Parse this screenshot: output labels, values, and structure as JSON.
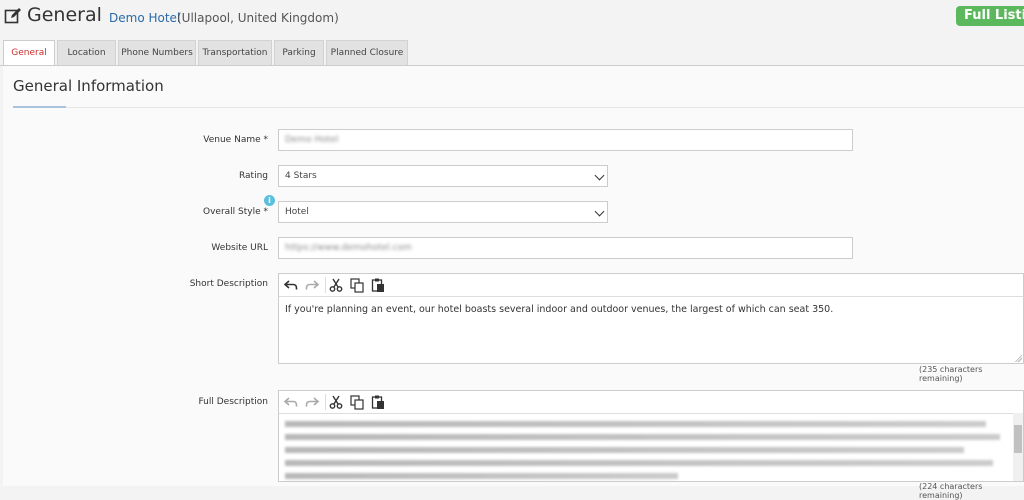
{
  "header": {
    "title": "General",
    "hotel_name": "Demo Hotel",
    "location": "(Ullapool, United Kingdom)",
    "full_listing_button": "Full Listing"
  },
  "tabs": [
    {
      "label": "General",
      "active": true
    },
    {
      "label": "Location",
      "active": false
    },
    {
      "label": "Phone Numbers",
      "active": false
    },
    {
      "label": "Transportation",
      "active": false
    },
    {
      "label": "Parking",
      "active": false
    },
    {
      "label": "Planned Closure",
      "active": false
    }
  ],
  "section": {
    "title": "General Information"
  },
  "form": {
    "venue_name": {
      "label": "Venue Name *",
      "value": "Demo Hotel"
    },
    "rating": {
      "label": "Rating",
      "value": "4 Stars"
    },
    "overall_style": {
      "label": "Overall Style *",
      "value": "Hotel",
      "info_icon": "i"
    },
    "website_url": {
      "label": "Website URL",
      "value": "https://www.demohotel.com"
    },
    "short_description": {
      "label": "Short Description",
      "text": "If you're planning an event, our hotel boasts several indoor and outdoor venues, the largest of which can seat 350.",
      "remaining": "(235 characters remaining)"
    },
    "full_description": {
      "label": "Full Description",
      "remaining": "(224 characters remaining)"
    }
  },
  "icons": {
    "title": "edit-icon",
    "undo": "undo-icon",
    "redo": "redo-icon",
    "cut": "cut-icon",
    "copy": "copy-icon",
    "paste": "paste-icon"
  },
  "colors": {
    "accent_link": "#2a6aa9",
    "active_tab": "#c9302c",
    "full_listing": "#5cb85c",
    "info_badge": "#5bc0de"
  }
}
